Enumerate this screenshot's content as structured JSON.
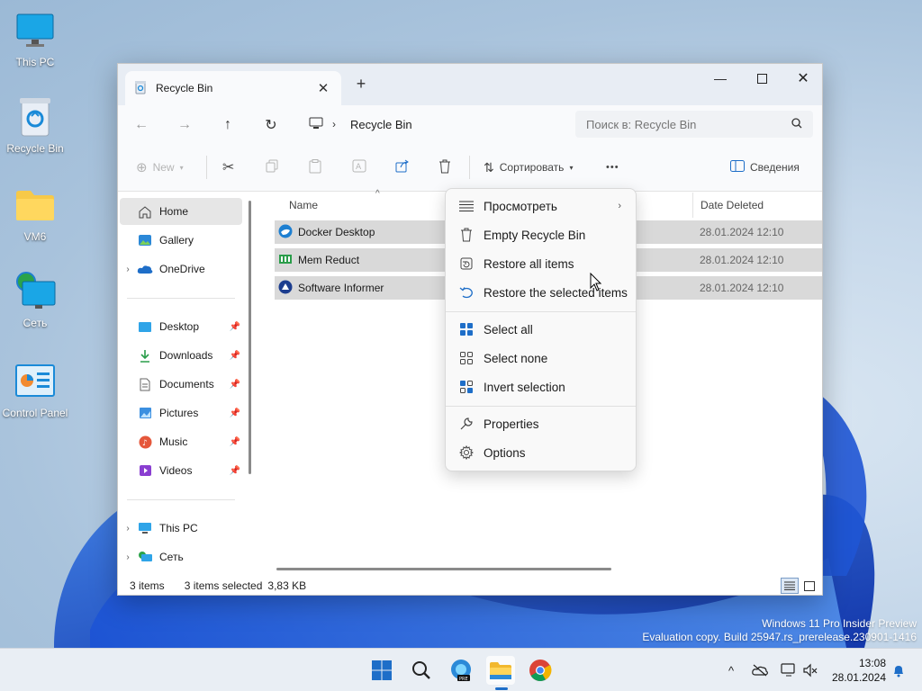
{
  "desktop": {
    "icons": [
      {
        "label": "This PC",
        "icon": "monitor-icon"
      },
      {
        "label": "Recycle Bin",
        "icon": "recycle-bin-icon"
      },
      {
        "label": "VM6",
        "icon": "folder-icon"
      },
      {
        "label": "Сеть",
        "icon": "network-icon"
      },
      {
        "label": "Control Panel",
        "icon": "control-panel-icon"
      }
    ]
  },
  "window": {
    "tab_title": "Recycle Bin",
    "address": "Recycle Bin",
    "search_placeholder": "Поиск в: Recycle Bin",
    "toolbar": {
      "new_label": "New",
      "sort_label": "Сортировать",
      "more_label": "•••",
      "details_label": "Сведения"
    },
    "sidebar": {
      "items": [
        {
          "label": "Home",
          "icon": "home-icon"
        },
        {
          "label": "Gallery",
          "icon": "gallery-icon"
        },
        {
          "label": "OneDrive",
          "icon": "cloud-icon"
        },
        {
          "label": "Desktop",
          "icon": "desktop-icon"
        },
        {
          "label": "Downloads",
          "icon": "download-icon"
        },
        {
          "label": "Documents",
          "icon": "document-icon"
        },
        {
          "label": "Pictures",
          "icon": "pictures-icon"
        },
        {
          "label": "Music",
          "icon": "music-icon"
        },
        {
          "label": "Videos",
          "icon": "videos-icon"
        },
        {
          "label": "This PC",
          "icon": "monitor-icon"
        },
        {
          "label": "Сеть",
          "icon": "network-icon"
        }
      ]
    },
    "columns": {
      "name": "Name",
      "date_deleted": "Date Deleted"
    },
    "rows": [
      {
        "name": "Docker Desktop",
        "date": "28.01.2024 12:10"
      },
      {
        "name": "Mem Reduct",
        "date": "28.01.2024 12:10"
      },
      {
        "name": "Software Informer",
        "date": "28.01.2024 12:10"
      }
    ],
    "status": {
      "count": "3 items",
      "selected": "3 items selected",
      "size": "3,83 KB"
    }
  },
  "context_menu": {
    "items": [
      {
        "label": "Просмотреть",
        "icon": "view-list-icon"
      },
      {
        "label": "Empty Recycle Bin",
        "icon": "trash-icon"
      },
      {
        "label": "Restore all items",
        "icon": "restore-all-icon"
      },
      {
        "label": "Restore the selected items",
        "icon": "undo-icon"
      },
      {
        "label": "Select all",
        "icon": "select-all-icon"
      },
      {
        "label": "Select none",
        "icon": "select-none-icon"
      },
      {
        "label": "Invert selection",
        "icon": "invert-selection-icon"
      },
      {
        "label": "Properties",
        "icon": "wrench-icon"
      },
      {
        "label": "Options",
        "icon": "gear-icon"
      }
    ]
  },
  "watermark": {
    "line1": "Windows 11 Pro Insider Preview",
    "line2": "Evaluation copy. Build 25947.rs_prerelease.230901-1416"
  },
  "clock": {
    "time": "13:08",
    "date": "28.01.2024"
  },
  "colors": {
    "accent": "#1e6ec8",
    "selection": "#d9d9d9"
  }
}
